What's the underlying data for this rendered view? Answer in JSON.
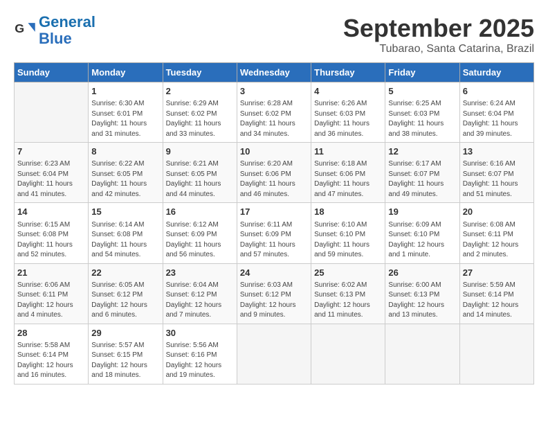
{
  "header": {
    "logo_general": "General",
    "logo_blue": "Blue",
    "month": "September 2025",
    "location": "Tubarao, Santa Catarina, Brazil"
  },
  "weekdays": [
    "Sunday",
    "Monday",
    "Tuesday",
    "Wednesday",
    "Thursday",
    "Friday",
    "Saturday"
  ],
  "weeks": [
    [
      {
        "day": null
      },
      {
        "day": 1,
        "sunrise": "6:30 AM",
        "sunset": "6:01 PM",
        "daylight": "11 hours and 31 minutes."
      },
      {
        "day": 2,
        "sunrise": "6:29 AM",
        "sunset": "6:02 PM",
        "daylight": "11 hours and 33 minutes."
      },
      {
        "day": 3,
        "sunrise": "6:28 AM",
        "sunset": "6:02 PM",
        "daylight": "11 hours and 34 minutes."
      },
      {
        "day": 4,
        "sunrise": "6:26 AM",
        "sunset": "6:03 PM",
        "daylight": "11 hours and 36 minutes."
      },
      {
        "day": 5,
        "sunrise": "6:25 AM",
        "sunset": "6:03 PM",
        "daylight": "11 hours and 38 minutes."
      },
      {
        "day": 6,
        "sunrise": "6:24 AM",
        "sunset": "6:04 PM",
        "daylight": "11 hours and 39 minutes."
      }
    ],
    [
      {
        "day": 7,
        "sunrise": "6:23 AM",
        "sunset": "6:04 PM",
        "daylight": "11 hours and 41 minutes."
      },
      {
        "day": 8,
        "sunrise": "6:22 AM",
        "sunset": "6:05 PM",
        "daylight": "11 hours and 42 minutes."
      },
      {
        "day": 9,
        "sunrise": "6:21 AM",
        "sunset": "6:05 PM",
        "daylight": "11 hours and 44 minutes."
      },
      {
        "day": 10,
        "sunrise": "6:20 AM",
        "sunset": "6:06 PM",
        "daylight": "11 hours and 46 minutes."
      },
      {
        "day": 11,
        "sunrise": "6:18 AM",
        "sunset": "6:06 PM",
        "daylight": "11 hours and 47 minutes."
      },
      {
        "day": 12,
        "sunrise": "6:17 AM",
        "sunset": "6:07 PM",
        "daylight": "11 hours and 49 minutes."
      },
      {
        "day": 13,
        "sunrise": "6:16 AM",
        "sunset": "6:07 PM",
        "daylight": "11 hours and 51 minutes."
      }
    ],
    [
      {
        "day": 14,
        "sunrise": "6:15 AM",
        "sunset": "6:08 PM",
        "daylight": "11 hours and 52 minutes."
      },
      {
        "day": 15,
        "sunrise": "6:14 AM",
        "sunset": "6:08 PM",
        "daylight": "11 hours and 54 minutes."
      },
      {
        "day": 16,
        "sunrise": "6:12 AM",
        "sunset": "6:09 PM",
        "daylight": "11 hours and 56 minutes."
      },
      {
        "day": 17,
        "sunrise": "6:11 AM",
        "sunset": "6:09 PM",
        "daylight": "11 hours and 57 minutes."
      },
      {
        "day": 18,
        "sunrise": "6:10 AM",
        "sunset": "6:10 PM",
        "daylight": "11 hours and 59 minutes."
      },
      {
        "day": 19,
        "sunrise": "6:09 AM",
        "sunset": "6:10 PM",
        "daylight": "12 hours and 1 minute."
      },
      {
        "day": 20,
        "sunrise": "6:08 AM",
        "sunset": "6:11 PM",
        "daylight": "12 hours and 2 minutes."
      }
    ],
    [
      {
        "day": 21,
        "sunrise": "6:06 AM",
        "sunset": "6:11 PM",
        "daylight": "12 hours and 4 minutes."
      },
      {
        "day": 22,
        "sunrise": "6:05 AM",
        "sunset": "6:12 PM",
        "daylight": "12 hours and 6 minutes."
      },
      {
        "day": 23,
        "sunrise": "6:04 AM",
        "sunset": "6:12 PM",
        "daylight": "12 hours and 7 minutes."
      },
      {
        "day": 24,
        "sunrise": "6:03 AM",
        "sunset": "6:12 PM",
        "daylight": "12 hours and 9 minutes."
      },
      {
        "day": 25,
        "sunrise": "6:02 AM",
        "sunset": "6:13 PM",
        "daylight": "12 hours and 11 minutes."
      },
      {
        "day": 26,
        "sunrise": "6:00 AM",
        "sunset": "6:13 PM",
        "daylight": "12 hours and 13 minutes."
      },
      {
        "day": 27,
        "sunrise": "5:59 AM",
        "sunset": "6:14 PM",
        "daylight": "12 hours and 14 minutes."
      }
    ],
    [
      {
        "day": 28,
        "sunrise": "5:58 AM",
        "sunset": "6:14 PM",
        "daylight": "12 hours and 16 minutes."
      },
      {
        "day": 29,
        "sunrise": "5:57 AM",
        "sunset": "6:15 PM",
        "daylight": "12 hours and 18 minutes."
      },
      {
        "day": 30,
        "sunrise": "5:56 AM",
        "sunset": "6:16 PM",
        "daylight": "12 hours and 19 minutes."
      },
      {
        "day": null
      },
      {
        "day": null
      },
      {
        "day": null
      },
      {
        "day": null
      }
    ]
  ],
  "labels": {
    "sunrise": "Sunrise:",
    "sunset": "Sunset:",
    "daylight": "Daylight:"
  }
}
